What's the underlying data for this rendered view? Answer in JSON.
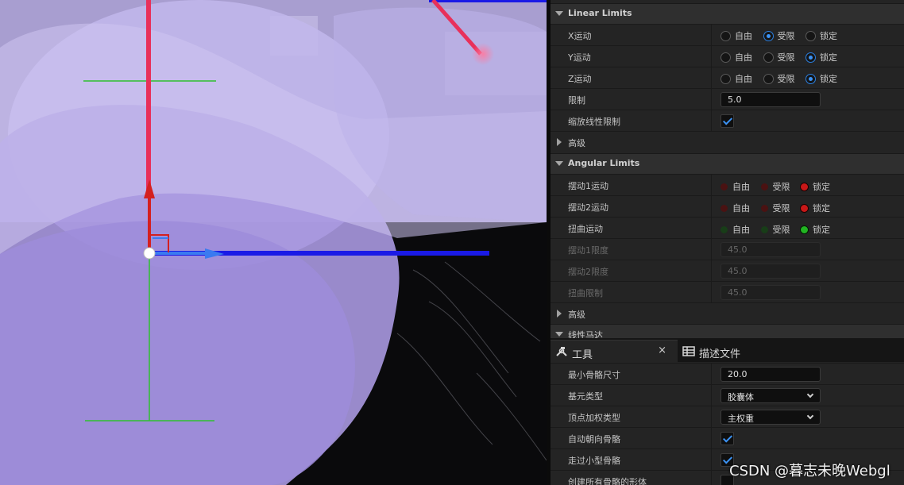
{
  "details": {
    "linear_limits": {
      "title": "Linear Limits",
      "rows": [
        {
          "label": "X运动",
          "options": [
            "自由",
            "受限",
            "锁定"
          ],
          "selected": 1
        },
        {
          "label": "Y运动",
          "options": [
            "自由",
            "受限",
            "锁定"
          ],
          "selected": 2
        },
        {
          "label": "Z运动",
          "options": [
            "自由",
            "受限",
            "锁定"
          ],
          "selected": 2
        }
      ],
      "limit_label": "限制",
      "limit_value": "5.0",
      "scale_label": "缩放线性限制",
      "scale_checked": true,
      "advanced_label": "高级"
    },
    "angular_limits": {
      "title": "Angular Limits",
      "rows": [
        {
          "label": "摆动1运动",
          "options": [
            "自由",
            "受限",
            "锁定"
          ],
          "selected": 2,
          "color": "red"
        },
        {
          "label": "摆动2运动",
          "options": [
            "自由",
            "受限",
            "锁定"
          ],
          "selected": 2,
          "color": "red"
        },
        {
          "label": "扭曲运动",
          "options": [
            "自由",
            "受限",
            "锁定"
          ],
          "selected": 2,
          "color": "green"
        }
      ],
      "limits": [
        {
          "label": "摆动1限度",
          "value": "45.0"
        },
        {
          "label": "摆动2限度",
          "value": "45.0"
        },
        {
          "label": "扭曲限制",
          "value": "45.0"
        }
      ],
      "advanced_label": "高级"
    },
    "next_category_label": "线性马达"
  },
  "tabs": [
    {
      "label": "工具",
      "icon": "hammer-wrench-icon",
      "active": true
    },
    {
      "label": "描述文件",
      "icon": "profile-table-icon",
      "active": false
    }
  ],
  "tab_close": "×",
  "tools": {
    "min_bone_size_label": "最小骨骼尺寸",
    "min_bone_size_value": "20.0",
    "primitive_type_label": "基元类型",
    "primitive_type_value": "胶囊体",
    "vertex_weight_label": "顶点加权类型",
    "vertex_weight_value": "主权重",
    "auto_orient_label": "自动朝向骨骼",
    "auto_orient_checked": true,
    "walk_small_label": "走过小型骨骼",
    "walk_small_checked": true,
    "create_all_label": "创建所有骨骼的形体",
    "create_all_checked": false
  },
  "watermark": "CSDN @暮志未晚Webgl",
  "colors": {
    "accent": "#3c93f5",
    "panel_bg": "#242424",
    "category_bg": "#2f2f2f",
    "lock_red": "#c81818",
    "lock_green": "#22b422",
    "gizmo_x_blue": "#1a1ae6",
    "gizmo_z_red": "#d42020",
    "constraint_pink": "#e8305a",
    "physics_body_purple": "#b4a4ec"
  }
}
